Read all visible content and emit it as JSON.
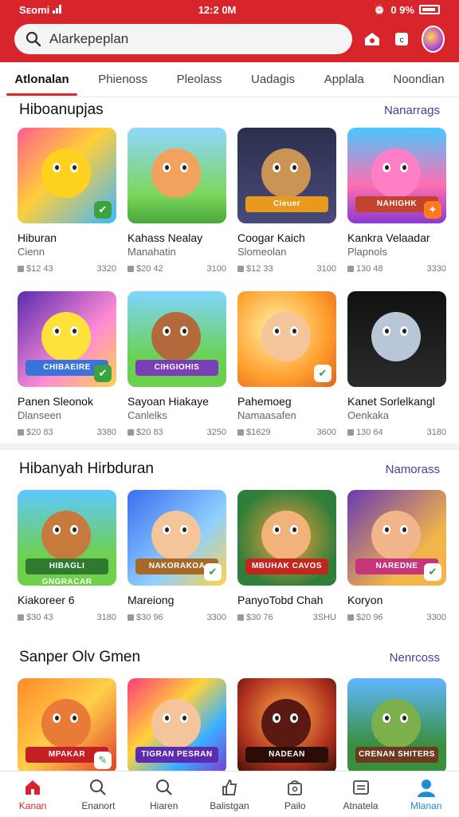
{
  "status": {
    "carrier": "Sᴇomi",
    "time": "12:2 0M",
    "battery": "0 9%"
  },
  "search": {
    "placeholder": "Alarkepeplan"
  },
  "tabs": [
    {
      "label": "Atlonalan",
      "active": true
    },
    {
      "label": "Phienoss",
      "active": false
    },
    {
      "label": "Pleolass",
      "active": false
    },
    {
      "label": "Uadagis",
      "active": false
    },
    {
      "label": "Applala",
      "active": false
    },
    {
      "label": "Noondian",
      "active": false
    }
  ],
  "sections": [
    {
      "title": "Hiboanupjas",
      "more": "Nanarrags",
      "rows": [
        [
          {
            "name": "Hiburan",
            "sub": "Cienn",
            "price": "$12 43",
            "count": "3320",
            "art": "yellow-hero",
            "badge": "leaf"
          },
          {
            "name": "Kahass Nealay",
            "sub": "Manahatin",
            "price": "$20 42",
            "count": "3100",
            "art": "jump-kids",
            "badge": ""
          },
          {
            "name": "Coogar Kaich",
            "sub": "Slomeolan",
            "price": "$12 33",
            "count": "3100",
            "art": "bear-box",
            "badge": ""
          },
          {
            "name": "Kankra Velaadar",
            "sub": "Plapnols",
            "price": "130 48",
            "count": "3330",
            "art": "pink-bunny",
            "badge": "fire"
          }
        ],
        [
          {
            "name": "Panen Sleonok",
            "sub": "Dlanseen",
            "price": "$20 83",
            "count": "3380",
            "art": "bubble-pals",
            "badge": "leaf"
          },
          {
            "name": "Sayoan Hiakaye",
            "sub": "Canlelks",
            "price": "$20 83",
            "count": "3250",
            "art": "monkey-fun",
            "badge": ""
          },
          {
            "name": "Pahemoeg",
            "sub": "Namaasafen",
            "price": "$1629",
            "count": "3600",
            "art": "kid-cannon",
            "badge": "check"
          },
          {
            "name": "Kanet Sorlelkangl",
            "sub": "Oenkaka",
            "price": "130 64",
            "count": "3180",
            "art": "robot-mouse",
            "badge": ""
          }
        ]
      ]
    },
    {
      "title": "Hibanyah Hirbduran",
      "more": "Namorass",
      "rows": [
        [
          {
            "name": "Kiakoreer 6",
            "sub": "",
            "price": "$30 43",
            "count": "3180",
            "art": "banner-kid",
            "badge": ""
          },
          {
            "name": "Mareiong",
            "sub": "",
            "price": "$30 96",
            "count": "3300",
            "art": "blonde-kid",
            "badge": "check"
          },
          {
            "name": "PanyoTobd Chah",
            "sub": "",
            "price": "$30 76",
            "count": "3SHU",
            "art": "mbuhak",
            "badge": ""
          },
          {
            "name": "Koryon",
            "sub": "",
            "price": "$20 96",
            "count": "3300",
            "art": "girl-banner",
            "badge": "check"
          }
        ]
      ]
    },
    {
      "title": "Sanper Olv Gmen",
      "more": "Nenrcoss",
      "rows": [
        [
          {
            "name": "",
            "sub": "",
            "price": "",
            "count": "",
            "art": "mpakar",
            "badge": "wrench"
          },
          {
            "name": "",
            "sub": "",
            "price": "",
            "count": "",
            "art": "pesran",
            "badge": ""
          },
          {
            "name": "",
            "sub": "",
            "price": "",
            "count": "",
            "art": "nadean",
            "badge": ""
          },
          {
            "name": "",
            "sub": "",
            "price": "",
            "count": "",
            "art": "shiters",
            "badge": ""
          }
        ]
      ]
    }
  ],
  "thumb_text": {
    "bear-box": "Cieuer",
    "pink-bunny": "NAHIGHK",
    "bubble-pals": "CHIBAEIRE",
    "monkey-fun": "CIHGIOHIS",
    "banner-kid": "HIBAGLI GNGRACAR",
    "blonde-kid": "NAKORAKOA",
    "mbuhak": "MBUHAK CAVOS",
    "girl-banner": "NAREDNE",
    "mpakar": "MPAKAR",
    "pesran": "TIGRAN PESRAN",
    "nadean": "NADEAN",
    "shiters": "CRENAN SHITERS"
  },
  "bottom_nav": [
    {
      "label": "Kanan",
      "icon": "home-icon"
    },
    {
      "label": "Enanort",
      "icon": "search-icon"
    },
    {
      "label": "Hiaren",
      "icon": "search-icon"
    },
    {
      "label": "Balistgan",
      "icon": "thumb-icon"
    },
    {
      "label": "Pailo",
      "icon": "bag-icon"
    },
    {
      "label": "Atnatela",
      "icon": "list-icon"
    },
    {
      "label": "Mlanan",
      "icon": "profile-icon"
    }
  ],
  "colors": {
    "brand": "#d8252c",
    "link": "#3f3f9e",
    "active_nav": "#1a8fd6"
  }
}
